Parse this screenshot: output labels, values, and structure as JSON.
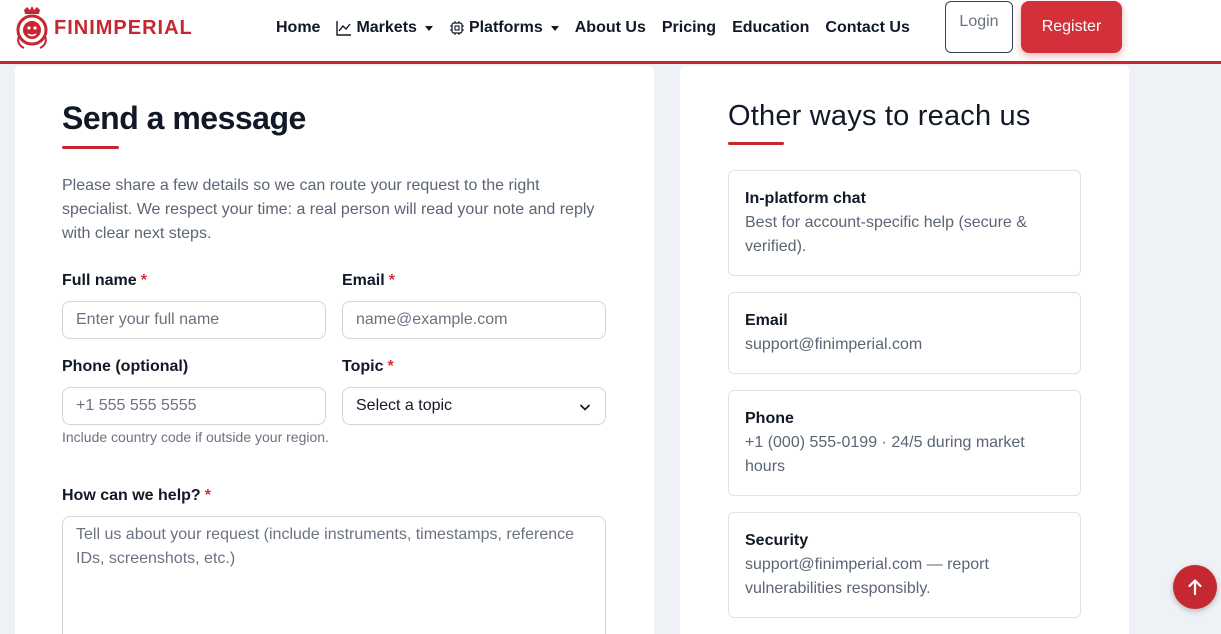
{
  "brand": {
    "name": "FINIMPERIAL",
    "color": "#c62832"
  },
  "nav": {
    "items": [
      {
        "label": "Home",
        "icon": "",
        "dropdown": false
      },
      {
        "label": "Markets",
        "icon": "chart-line-icon",
        "dropdown": true
      },
      {
        "label": "Platforms",
        "icon": "cpu-chip-icon",
        "dropdown": true
      },
      {
        "label": "About Us",
        "icon": "",
        "dropdown": false
      },
      {
        "label": "Pricing",
        "icon": "",
        "dropdown": false
      },
      {
        "label": "Education",
        "icon": "",
        "dropdown": false
      },
      {
        "label": "Contact Us",
        "icon": "",
        "dropdown": false
      }
    ],
    "login_label": "Login",
    "register_label": "Register"
  },
  "form": {
    "title": "Send a message",
    "intro": "Please share a few details so we can route your request to the right specialist. We respect your time: a real person will read your note and reply with clear next steps.",
    "required_mark": "*",
    "full_name": {
      "label": "Full name",
      "placeholder": "Enter your full name",
      "required": true
    },
    "email": {
      "label": "Email",
      "placeholder": "name@example.com",
      "required": true
    },
    "phone": {
      "label": "Phone (optional)",
      "placeholder": "+1 555 555 5555",
      "help": "Include country code if outside your region.",
      "required": false
    },
    "topic": {
      "label": "Topic",
      "selected": "Select a topic",
      "required": true
    },
    "message": {
      "label": "How can we help?",
      "placeholder": "Tell us about your request (include instruments, timestamps, reference IDs, screenshots, etc.)",
      "required": true
    }
  },
  "other": {
    "title": "Other ways to reach us",
    "items": [
      {
        "title": "In-platform chat",
        "body": "Best for account-specific help (secure & verified)."
      },
      {
        "title": "Email",
        "body": "support@finimperial.com"
      },
      {
        "title": "Phone",
        "body": "+1 (000) 555-0199 · 24/5 during market hours"
      },
      {
        "title": "Security",
        "body": "support@finimperial.com — report vulnerabilities responsibly."
      }
    ]
  },
  "colors": {
    "accent": "#c62832",
    "register_bg": "#d3303a",
    "page_bg": "#eef1f5"
  },
  "scroll_top": {
    "icon": "arrow-up-icon"
  }
}
